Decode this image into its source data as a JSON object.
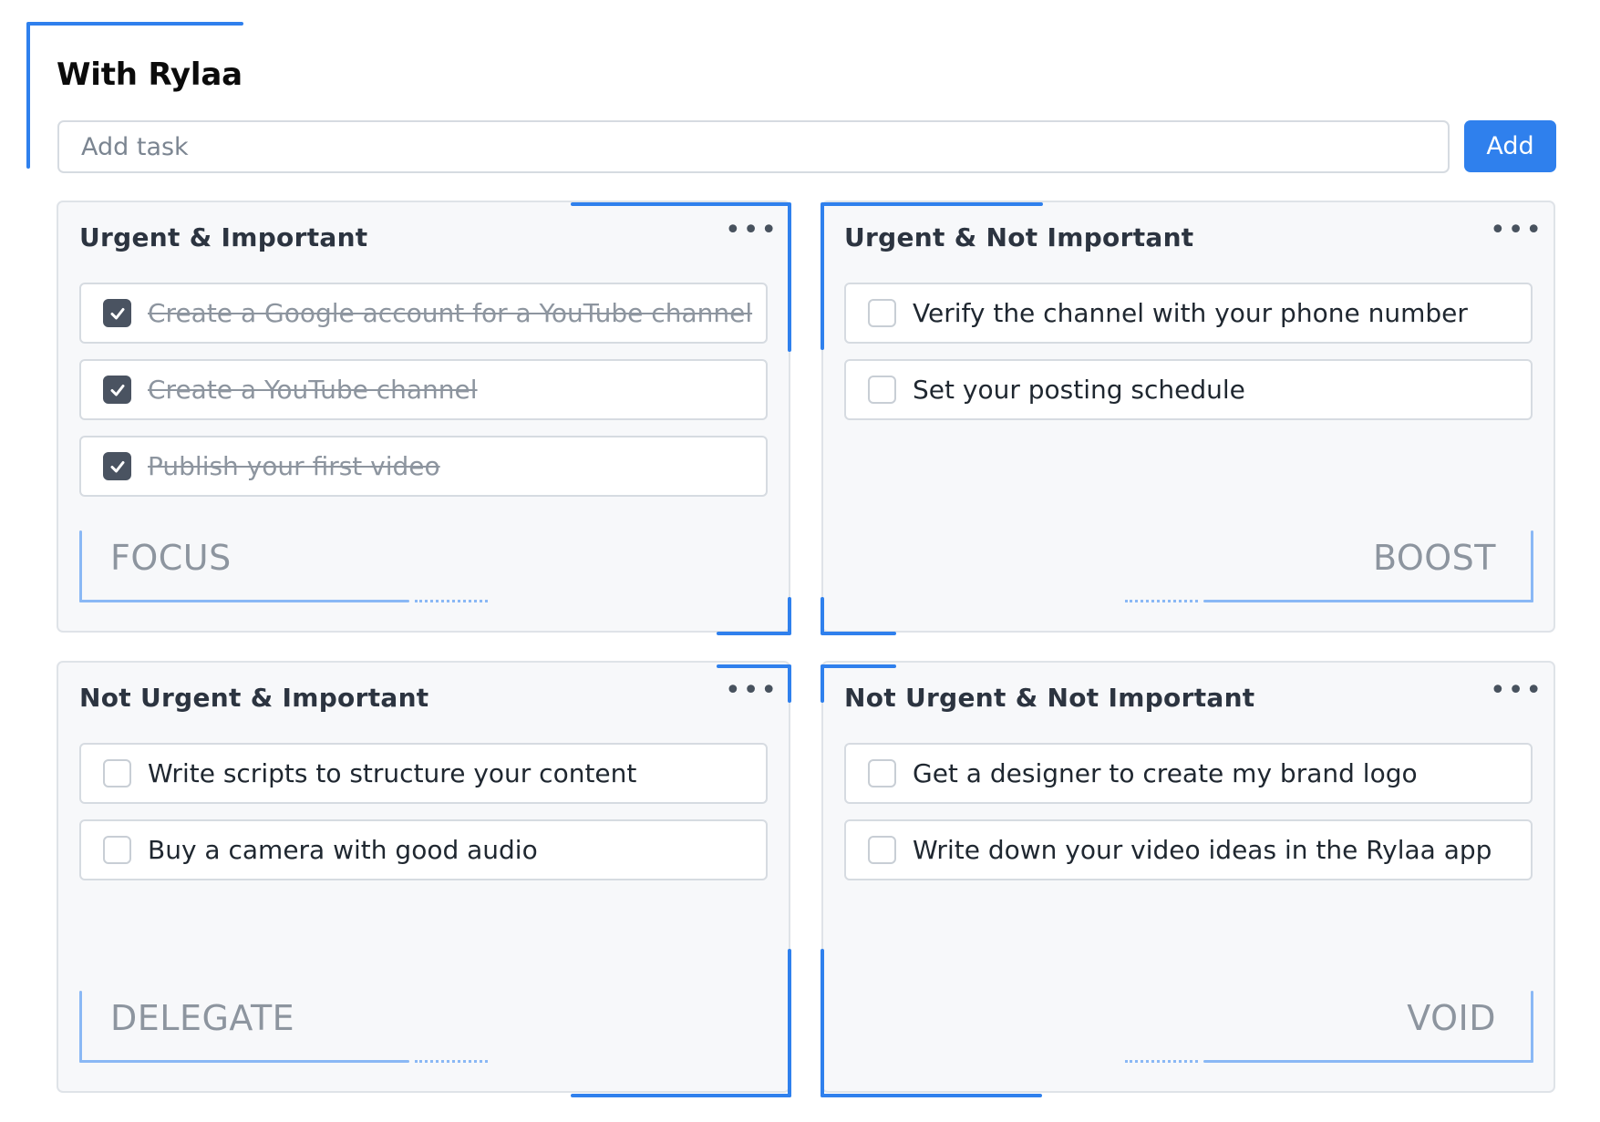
{
  "app": {
    "title": "With Rylaa"
  },
  "add_task": {
    "placeholder": "Add task",
    "button_label": "Add"
  },
  "quadrants": [
    {
      "title": "Urgent & Important",
      "label": "FOCUS",
      "tasks": [
        {
          "text": "Create a Google account for a YouTube channel",
          "done": true
        },
        {
          "text": "Create a YouTube channel",
          "done": true
        },
        {
          "text": "Publish your first video",
          "done": true
        }
      ]
    },
    {
      "title": "Urgent & Not Important",
      "label": "BOOST",
      "tasks": [
        {
          "text": "Verify the channel with your phone number",
          "done": false
        },
        {
          "text": "Set your posting schedule",
          "done": false
        }
      ]
    },
    {
      "title": "Not Urgent & Important",
      "label": "DELEGATE",
      "tasks": [
        {
          "text": "Write scripts to structure your content",
          "done": false
        },
        {
          "text": "Buy a camera with good audio",
          "done": false
        }
      ]
    },
    {
      "title": "Not Urgent & Not Important",
      "label": "VOID",
      "tasks": [
        {
          "text": "Get a designer to create my brand logo",
          "done": false
        },
        {
          "text": "Write down your video ideas in the Rylaa app",
          "done": false
        }
      ]
    }
  ],
  "colors": {
    "accent": "#2f80ed",
    "muted_text": "#8d959f",
    "panel_bg": "#f7f8fa"
  },
  "icons": {
    "more": "more-horizontal-icon",
    "check": "check-icon"
  }
}
